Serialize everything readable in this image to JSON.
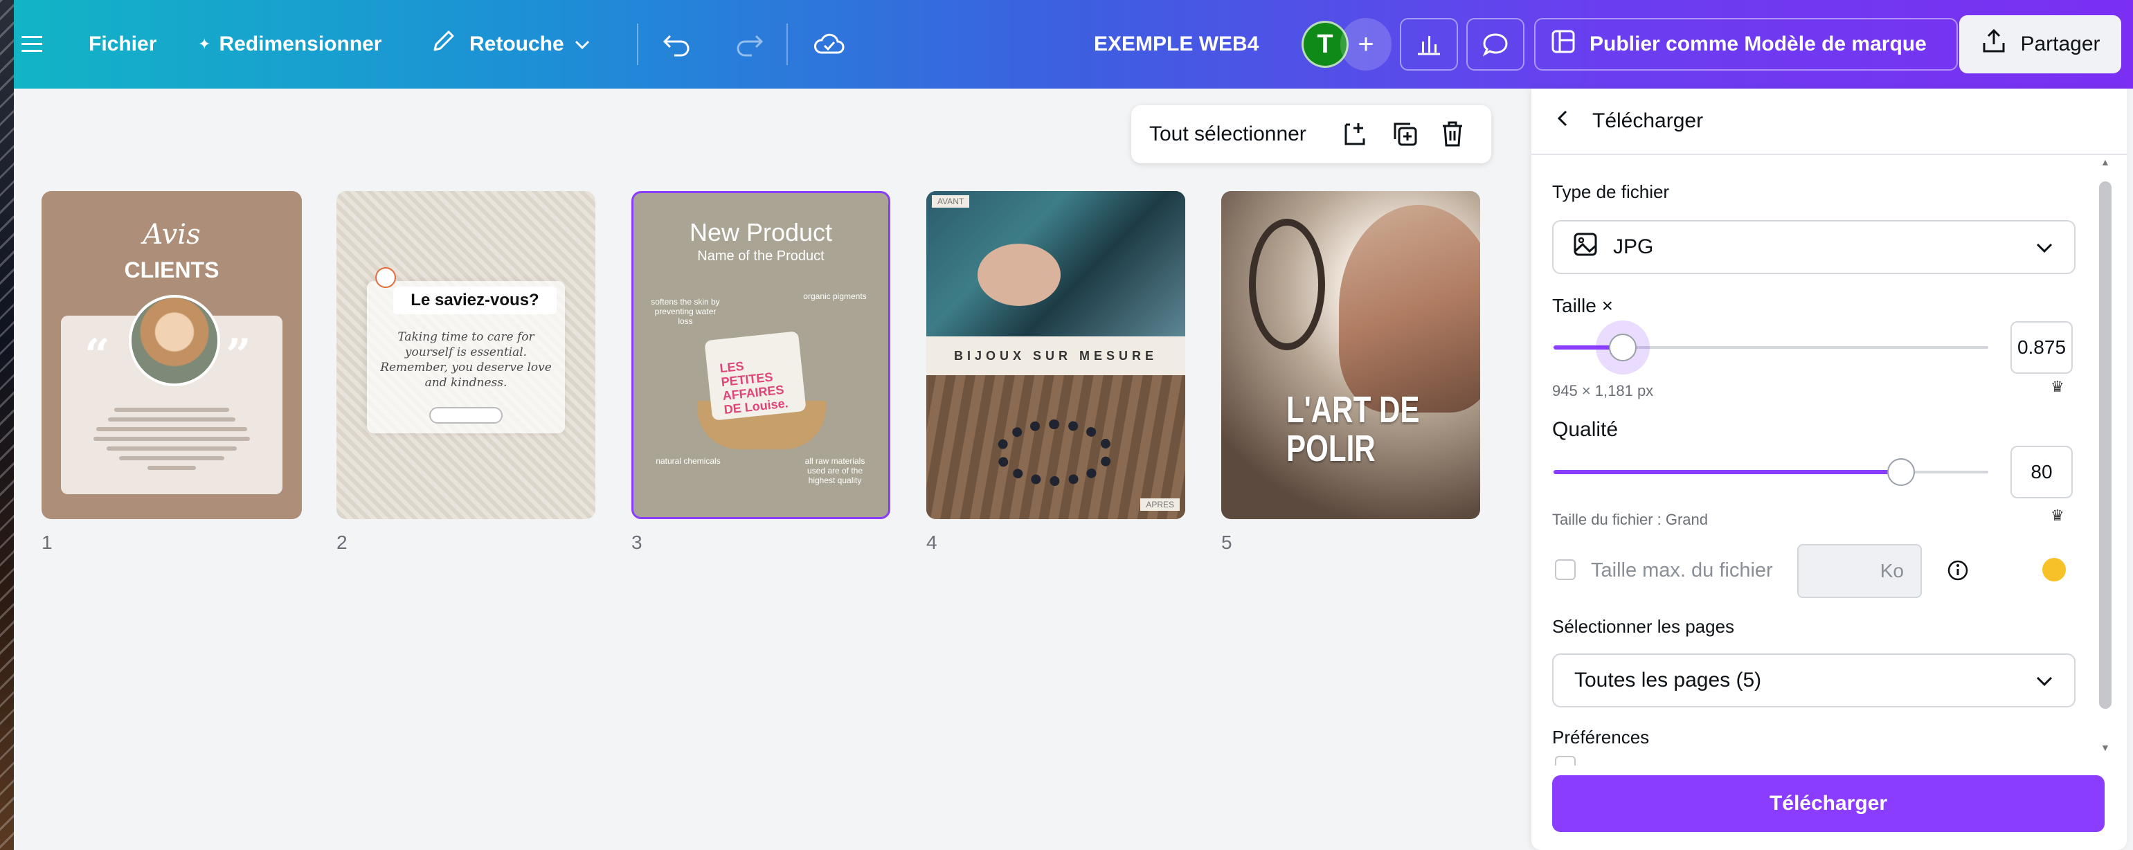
{
  "topbar": {
    "menu_icon": "hamburger-icon",
    "file_label": "Fichier",
    "resize_label": "Redimensionner",
    "retouch_label": "Retouche",
    "title": "EXEMPLE WEB4",
    "avatar_letter": "T",
    "publish_label": "Publier comme Modèle de marque",
    "share_label": "Partager",
    "gradient_start": "#12b4c6",
    "gradient_end": "#7b2ff2"
  },
  "canvas": {
    "select_all_label": "Tout sélectionner",
    "pages": [
      {
        "number": "1",
        "script_title": "Avis",
        "title": "CLIENTS"
      },
      {
        "number": "2",
        "heading": "Le saviez-vous?",
        "body": "Taking time to care for yourself is essential. Remember, you deserve love and kindness."
      },
      {
        "number": "3",
        "heading": "New Product",
        "subheading": "Name of the Product",
        "pillow_text": "LES PETITES AFFAIRES DE Louise.",
        "tags": [
          "softens the skin by preventing water loss",
          "organic pigments",
          "natural chemicals",
          "all raw materials used are of the highest quality"
        ]
      },
      {
        "number": "4",
        "band_text": "BIJOUX SUR MESURE",
        "before_label": "AVANT",
        "after_label": "APRES"
      },
      {
        "number": "5",
        "overlay_text_line1": "L'ART DE",
        "overlay_text_line2": "POLIR"
      }
    ]
  },
  "panel": {
    "back_label": "Télécharger",
    "file_type_label": "Type de fichier",
    "file_type_value": "JPG",
    "size_label": "Taille ×",
    "size_value": "0.875",
    "size_fraction": 0.16,
    "size_dims": "945 × 1,181 px",
    "quality_label": "Qualité",
    "quality_value": "80",
    "quality_fraction": 0.8,
    "file_size_label": "Taille du fichier : Grand",
    "max_size_label": "Taille max. du fichier",
    "max_size_unit": "Ko",
    "select_pages_label": "Sélectionner les pages",
    "pages_value": "Toutes les pages (5)",
    "prefs_label": "Préférences",
    "download_button": "Télécharger",
    "accent": "#8b3dff"
  }
}
